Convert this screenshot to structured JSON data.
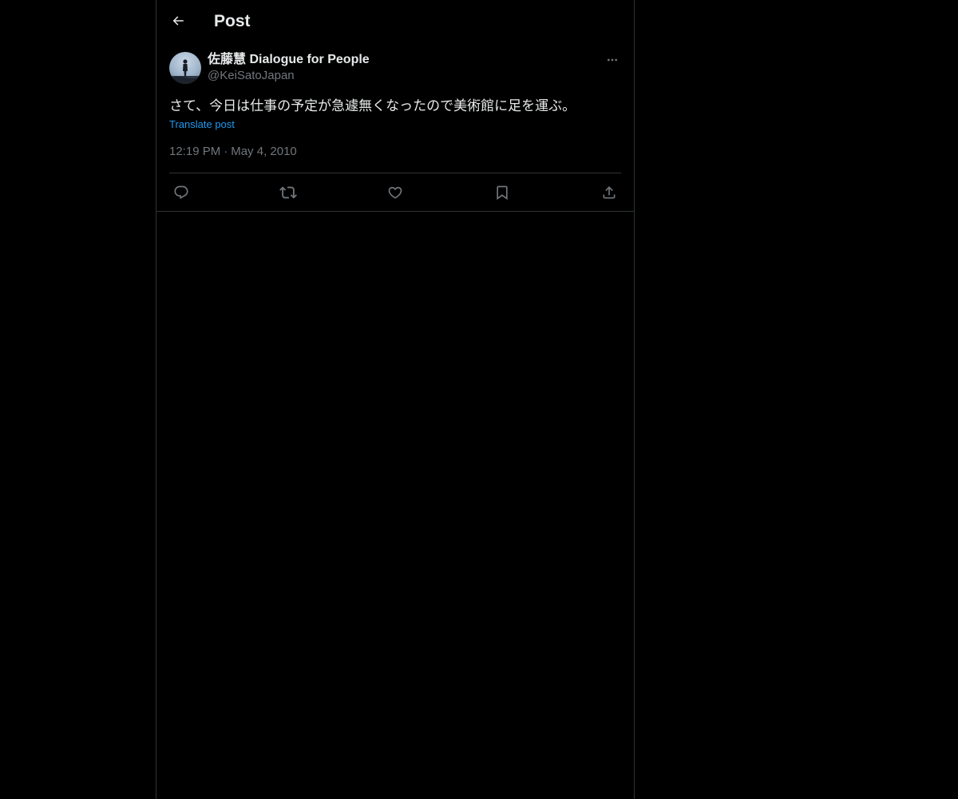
{
  "header": {
    "title": "Post",
    "back_icon": "arrow-left-icon"
  },
  "post": {
    "author": {
      "display_name": "佐藤慧 Dialogue for People",
      "handle": "@KeiSatoJapan"
    },
    "text": "さて、今日は仕事の予定が急遽無くなったので美術館に足を運ぶ。",
    "translate_label": "Translate post",
    "time": "12:19 PM",
    "separator": "·",
    "date": "May 4, 2010",
    "actions": [
      "reply-icon",
      "repost-icon",
      "like-icon",
      "bookmark-icon",
      "share-icon"
    ]
  },
  "colors": {
    "background": "#000000",
    "text": "#e7e9ea",
    "muted": "#71767b",
    "accent": "#1d9bf0",
    "border": "#2f3336"
  }
}
